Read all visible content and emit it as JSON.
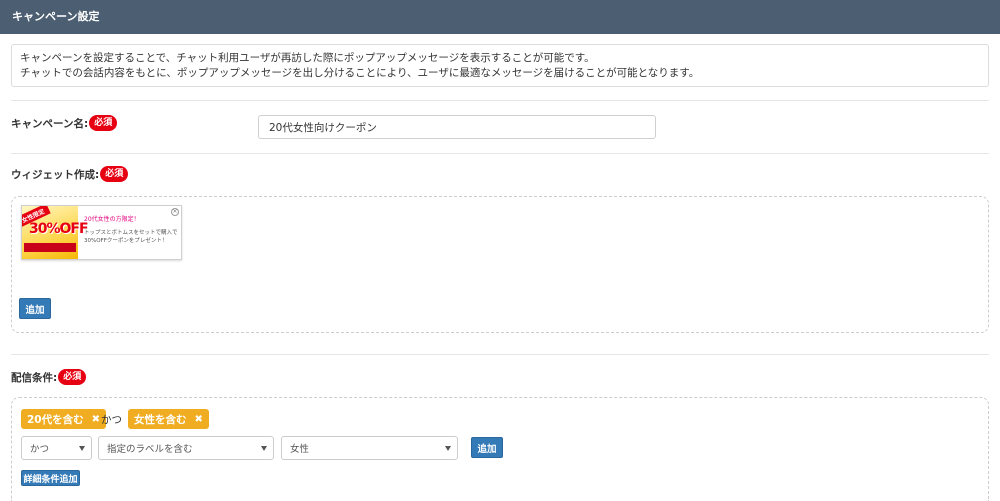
{
  "header": {
    "title": "キャンペーン設定"
  },
  "description": {
    "line1": "キャンペーンを設定することで、チャット利用ユーザが再訪した際にポップアップメッセージを表示することが可能です。",
    "line2": "チャットでの会話内容をもとに、ポップアップメッセージを出し分けることにより、ユーザに最適なメッセージを届けることが可能となります。"
  },
  "campaign_name": {
    "label": "キャンペーン名:",
    "required": "必須",
    "value": "20代女性向けクーポン"
  },
  "widget": {
    "label": "ウィジェット作成:",
    "required": "必須",
    "card": {
      "ribbon": "女性限定",
      "big_text": "30%OFF",
      "title": "20代女性の方限定！",
      "body_line1": "トップスとボトムスをセットで購入で",
      "body_line2": "30%OFFクーポンをプレゼント！",
      "close": "×"
    },
    "add_button": "追加"
  },
  "conditions": {
    "label": "配信条件:",
    "required": "必須",
    "tags": [
      {
        "text": "20代を含む",
        "remove": "✖"
      },
      {
        "text": "女性を含む",
        "remove": "✖"
      }
    ],
    "and_text": "かつ",
    "selects": {
      "operator": "かつ",
      "rule": "指定のラベルを含む",
      "value": "女性"
    },
    "add_button": "追加",
    "detail_button": "詳細条件追加"
  },
  "colors": {
    "header_bg": "#4c5e71",
    "required_badge": "#e60012",
    "tag_bg": "#f0ad22",
    "button_blue": "#337ab7"
  }
}
